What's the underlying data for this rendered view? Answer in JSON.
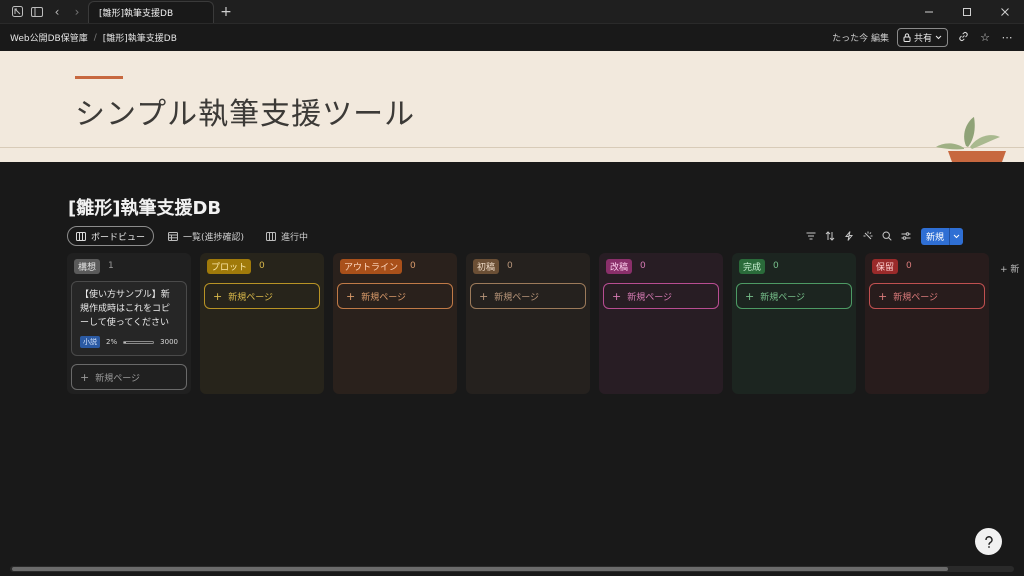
{
  "window": {
    "tab_title": "[雛形]執筆支援DB",
    "add_tab_glyph": "+"
  },
  "breadcrumb": {
    "items": [
      "Web公開DB保管庫",
      "[雛形]執筆支援DB"
    ],
    "separator": "/"
  },
  "header_actions": {
    "edited": "たった今 編集",
    "share_label": "共有"
  },
  "cover": {
    "title": "シンプル執筆支援ツール",
    "accent_color": "#c7683f",
    "background": "#f2e9dd"
  },
  "database": {
    "title": "[雛形]執筆支援DB",
    "views": [
      {
        "label": "ボードビュー",
        "icon": "board-icon",
        "active": true
      },
      {
        "label": "一覧(進捗確認)",
        "icon": "table-icon",
        "active": false
      },
      {
        "label": "進行中",
        "icon": "board-icon",
        "active": false
      }
    ],
    "new_button": "新規",
    "new_page_label": "新規ページ",
    "add_group_label": "+ 新"
  },
  "columns": [
    {
      "name": "構想",
      "count": "1",
      "tag_bg": "#5a5a5a",
      "tag_fg": "#e6e6e6",
      "col_bg": "#202020",
      "border": "#6a6a6a",
      "text": "#9a9a9a"
    },
    {
      "name": "プロット",
      "count": "0",
      "tag_bg": "#a07a0a",
      "tag_fg": "#fbe7a6",
      "col_bg": "#27241b",
      "border": "#b89325",
      "text": "#d9b84a"
    },
    {
      "name": "アウトライン",
      "count": "0",
      "tag_bg": "#a9501a",
      "tag_fg": "#ffd9c0",
      "col_bg": "#2a211c",
      "border": "#c07a47",
      "text": "#d99a6a"
    },
    {
      "name": "初稿",
      "count": "0",
      "tag_bg": "#6b4f35",
      "tag_fg": "#f0dcc8",
      "col_bg": "#25211e",
      "border": "#9c7a5a",
      "text": "#b9967a"
    },
    {
      "name": "改稿",
      "count": "0",
      "tag_bg": "#8a2f6a",
      "tag_fg": "#ffd0ef",
      "col_bg": "#281d24",
      "border": "#b84d92",
      "text": "#d57ab3"
    },
    {
      "name": "完成",
      "count": "0",
      "tag_bg": "#2a6b3a",
      "tag_fg": "#c9f0d2",
      "col_bg": "#1c2520",
      "border": "#4d9a64",
      "text": "#76bf8a"
    },
    {
      "name": "保留",
      "count": "0",
      "tag_bg": "#9a2a2a",
      "tag_fg": "#ffd0d0",
      "col_bg": "#281c1c",
      "border": "#c05050",
      "text": "#d97a7a"
    }
  ],
  "card": {
    "title": "【使い方サンプル】新規作成時はこれをコピーして使ってください",
    "tag": "小説",
    "progress": "2%",
    "progress_fraction": 0.02,
    "target": "3000"
  }
}
